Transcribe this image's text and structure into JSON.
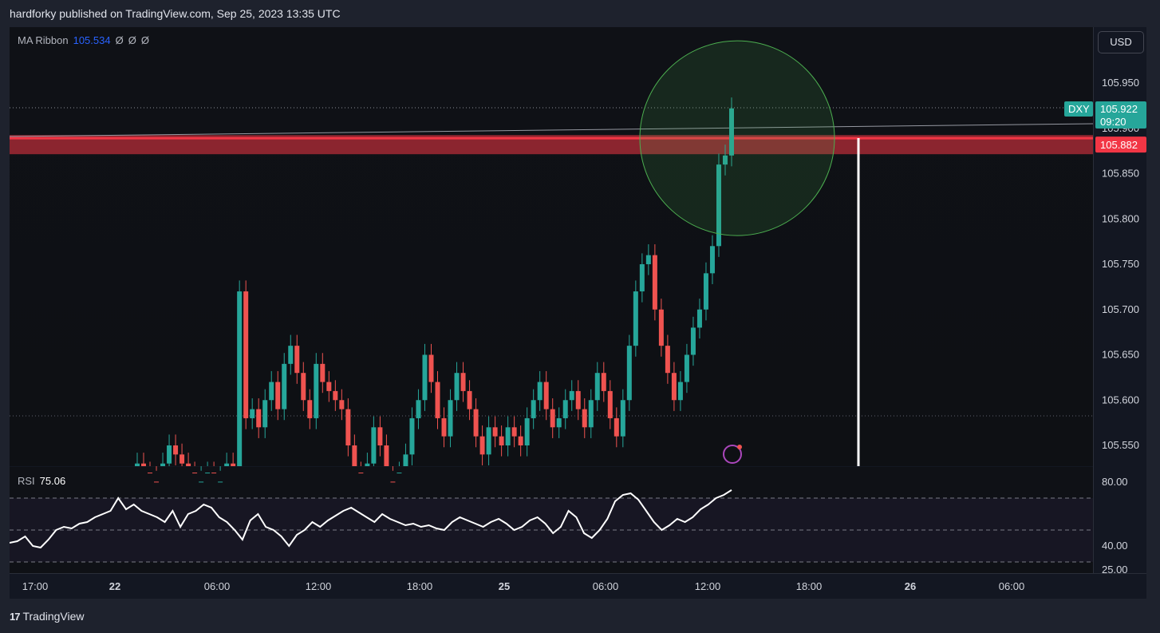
{
  "header": {
    "publisher_text": "hardforky published on TradingView.com, Sep 25, 2023 13:35 UTC"
  },
  "legend": {
    "indicator": "MA Ribbon",
    "value": "105.534",
    "extra": [
      "Ø",
      "Ø",
      "Ø"
    ]
  },
  "rsi_legend": {
    "label": "RSI",
    "value": "75.06"
  },
  "currency_button": "USD",
  "price_tag": {
    "symbol": "DXY",
    "price": "105.922",
    "countdown": "09:20"
  },
  "red_zone_tag": "105.882",
  "footer": {
    "brand": "TradingView"
  },
  "colors": {
    "up": "#26a69a",
    "down": "#ef5350",
    "zone": "#f23645",
    "circle": "#4caf50",
    "accent": "#2962ff",
    "rsi_line": "#ffffff"
  },
  "chart_data": [
    {
      "type": "candlestick",
      "symbol": "DXY",
      "ylim": [
        105.52,
        106.0
      ],
      "y_ticks": [
        "105.950",
        "105.900",
        "105.850",
        "105.800",
        "105.750",
        "105.700",
        "105.650",
        "105.600",
        "105.550"
      ],
      "x_ticks": [
        "17:00",
        "22",
        "06:00",
        "12:00",
        "18:00",
        "25",
        "06:00",
        "12:00",
        "18:00",
        "26",
        "06:00"
      ],
      "last_price": 105.922,
      "red_zone": 105.882,
      "close_series": [
        105.53,
        105.52,
        105.51,
        105.5,
        105.53,
        105.55,
        105.54,
        105.53,
        105.52,
        105.5,
        105.51,
        105.52,
        105.5,
        105.51,
        105.53,
        105.52,
        105.72,
        105.58,
        105.59,
        105.57,
        105.6,
        105.62,
        105.59,
        105.64,
        105.66,
        105.63,
        105.6,
        105.58,
        105.64,
        105.62,
        105.61,
        105.6,
        105.59,
        105.55,
        105.52,
        105.51,
        105.53,
        105.57,
        105.55,
        105.51,
        105.5,
        105.52,
        105.54,
        105.58,
        105.6,
        105.65,
        105.62,
        105.58,
        105.56,
        105.6,
        105.63,
        105.61,
        105.59,
        105.56,
        105.54,
        105.57,
        105.56,
        105.55,
        105.57,
        105.56,
        105.55,
        105.58,
        105.6,
        105.62,
        105.59,
        105.57,
        105.58,
        105.6,
        105.61,
        105.59,
        105.57,
        105.6,
        105.63,
        105.61,
        105.58,
        105.56,
        105.6,
        105.66,
        105.72,
        105.75,
        105.76,
        105.7,
        105.66,
        105.63,
        105.6,
        105.62,
        105.65,
        105.68,
        105.7,
        105.74,
        105.77,
        105.86,
        105.87,
        105.922
      ],
      "annotations": {
        "circle_center_price": 105.86,
        "vertical_marker": "25 20:30"
      }
    },
    {
      "type": "line",
      "name": "RSI",
      "ylim": [
        20,
        85
      ],
      "y_ticks": [
        "80.00",
        "40.00",
        "25.00"
      ],
      "levels": [
        70,
        50,
        30
      ],
      "values": [
        42,
        43,
        46,
        40,
        39,
        44,
        50,
        52,
        51,
        54,
        55,
        58,
        60,
        62,
        70,
        63,
        66,
        62,
        60,
        58,
        55,
        62,
        52,
        60,
        62,
        66,
        64,
        58,
        55,
        50,
        44,
        56,
        60,
        52,
        50,
        46,
        40,
        47,
        50,
        55,
        52,
        56,
        59,
        62,
        64,
        61,
        58,
        55,
        60,
        57,
        55,
        53,
        54,
        52,
        53,
        51,
        50,
        55,
        58,
        56,
        54,
        52,
        55,
        57,
        54,
        50,
        52,
        56,
        58,
        54,
        48,
        52,
        62,
        58,
        48,
        45,
        50,
        57,
        68,
        72,
        73,
        69,
        62,
        55,
        50,
        53,
        57,
        55,
        58,
        63,
        66,
        70,
        72,
        75.06
      ]
    }
  ]
}
